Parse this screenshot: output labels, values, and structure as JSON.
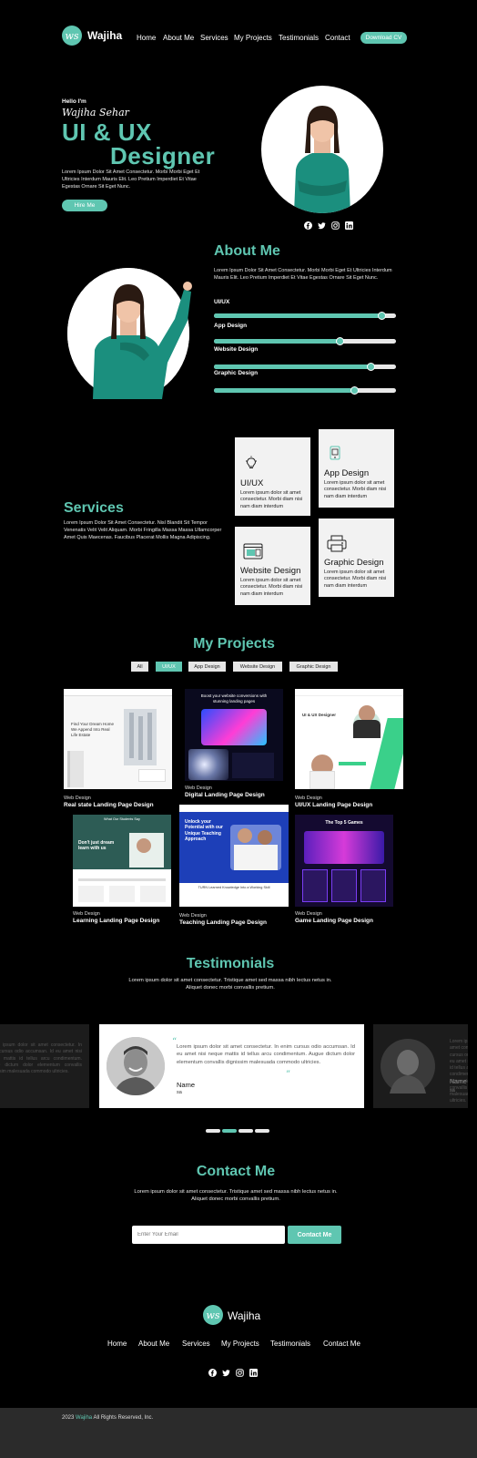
{
  "nav": {
    "logo_mark": "ws",
    "brand": "Wajiha",
    "links": [
      "Home",
      "About Me",
      "Services",
      "My Projects",
      "Testimonials",
      "Contact"
    ],
    "cta": "Download CV"
  },
  "hero": {
    "greeting": "Hello I'm",
    "name": "Wajiha Sehar",
    "title_line1": "UI & UX",
    "title_line2": "Designer",
    "description": "Lorem Ipsum Dolor Sit Amet Consectetur. Morbi Morbi Eget Et Ultricies Interdum Mauris Elit. Leo Pretium Imperdiet Et Vitae Egestas Ornare Sit Eget Nunc.",
    "button": "Hire Me",
    "socials": [
      "facebook-icon",
      "twitter-icon",
      "instagram-icon",
      "linkedin-icon"
    ]
  },
  "about": {
    "heading": "About Me",
    "description": "Lorem Ipsum Dolor Sit Amet Consectetur. Morbi Morbi Eget Et Ultricies Interdum Mauris Elit. Leo Pretium Imperdiet Et Vitae Egestas Ornare Sit Eget Nunc.",
    "skills": [
      {
        "label": "UI/UX",
        "level": 0.92
      },
      {
        "label": "App Design",
        "level": 0.69
      },
      {
        "label": "Website Design",
        "level": 0.86
      },
      {
        "label": "Graphic Design",
        "level": 0.77
      }
    ]
  },
  "services": {
    "heading": "Services",
    "description": "Lorem Ipsum Dolor Sit Amet Consectetur. Nisl Blandit Sit Tempor Venenatis Velit Velit Aliquam. Morbi Fringilla Massa Massa Ullamcorper Amet Quis Maecenas. Faucibus Placerat Mollis Magna Adipiscing.",
    "cards": [
      {
        "title": "UI/UX",
        "text": "Lorem ipsum dolor sit amet consectetur. Morbi diam nisi nam diam interdum",
        "icon": "lightbulb-icon"
      },
      {
        "title": "App Design",
        "text": "Lorem ipsum dolor sit amet consectetur. Morbi diam nisi nam diam interdum",
        "icon": "mobile-icon"
      },
      {
        "title": "Website Design",
        "text": "Lorem ipsum dolor sit amet consectetur. Morbi diam nisi nam diam interdum",
        "icon": "browser-icon"
      },
      {
        "title": "Graphic Design",
        "text": "Lorem ipsum dolor sit amet consectetur. Morbi diam nisi nam diam interdum",
        "icon": "printer-icon"
      }
    ]
  },
  "projects": {
    "heading": "My Projects",
    "tabs": [
      "All",
      "UI/UX",
      "App Design",
      "Website Design",
      "Graphic Design"
    ],
    "active_tab": "UI/UX",
    "items": [
      {
        "category": "Web Design",
        "title": "Real state Landing Page Design"
      },
      {
        "category": "Web Design",
        "title": "Digital Landing Page Design"
      },
      {
        "category": "Web Design",
        "title": "UI/UX Landing Page Design"
      },
      {
        "category": "Web Design",
        "title": "Learning Landing Page Design"
      },
      {
        "category": "Web Design",
        "title": "Teaching Landing Page Design"
      },
      {
        "category": "Web Design",
        "title": "Game Landing Page Design"
      }
    ],
    "thumb_texts": {
      "real_estate": "Find Your Dream Home We Append Into Real Life Estate",
      "digital": "Boost your website conversions with stunning landing pages",
      "uiux": "UI & UX Designer",
      "learning": "Don't just dream learn with us",
      "learning_top": "What Our Students Say",
      "teaching": "Unlock your Potential with our Unique Teaching Approach",
      "teaching_footer": "TURN Learned Knowledge Into a Working Skill",
      "game": "The Top 5 Games"
    }
  },
  "testimonials": {
    "heading": "Testimonials",
    "description": "Lorem ipsum dolor sit amet consectetur. Tristique amet sed massa nibh lectus netus in. Aliquet donec morbi convallis pretium.",
    "quote": "Lorem ipsum dolor sit amet consectetur. In enim cursus odio accumsan. Id eu amet nisi neque mattis id tellus arcu condimentum. Augue dictum dolor elementum convallis dignissim malesuada commodo ultricies.",
    "side_quote": "Lorem ipsum dolor sit amet consectetur. In enim cursus odio accumsan. Id eu amet nisi neque mattis id tellus arcu condimentum. Augue dictum dolor elementum convallis dignissim malesuada commodo ultricies.",
    "author_name": "Name",
    "author_role": "sa",
    "side_author": "Name",
    "side_role": "sa",
    "dots": 4,
    "active_dot": 1
  },
  "contact": {
    "heading": "Contact Me",
    "description": "Lorem ipsum dolor sit amet consectetur. Tristique amet sed massa nibh lectus netus in. Aliquet donec morbi convallis pretium.",
    "email_placeholder": "Enter Your Email",
    "button": "Contact Me"
  },
  "footer": {
    "brand": "Wajiha",
    "links": [
      "Home",
      "About Me",
      "Services",
      "My Projects",
      "Testimonials",
      "Contact Me"
    ],
    "copyright_prefix": "2023",
    "copyright_brand": "Wajiha",
    "copyright_suffix": "All Rights Reserved, Inc."
  },
  "colors": {
    "accent": "#5fc6b1",
    "background": "#000000",
    "card": "#f2f2f2"
  }
}
